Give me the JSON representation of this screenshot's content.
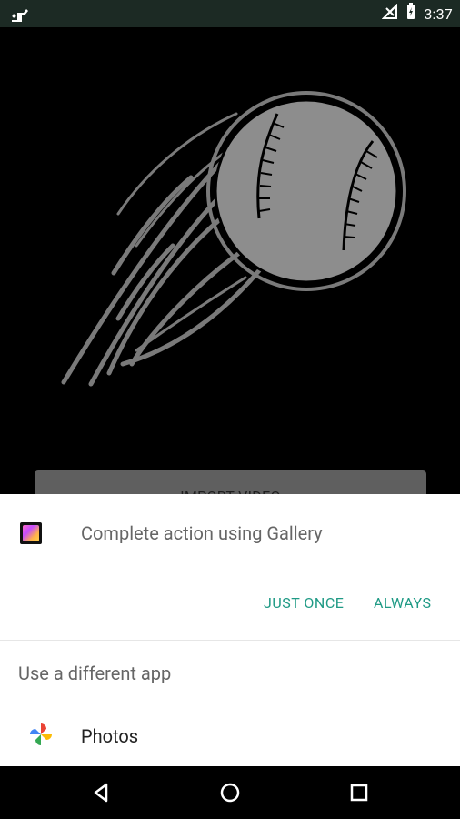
{
  "status_bar": {
    "time": "3:37"
  },
  "app": {
    "import_button_label": "IMPORT VIDEO"
  },
  "chooser": {
    "title": "Complete action using Gallery",
    "actions": {
      "just_once": "JUST ONCE",
      "always": "ALWAYS"
    },
    "different_app": "Use a different app",
    "options": [
      {
        "label": "Photos",
        "icon": "photos-icon"
      }
    ]
  },
  "nav": {
    "back": "back-icon",
    "home": "home-icon",
    "recents": "recents-icon"
  },
  "colors": {
    "status_bar_bg": "#1c2a24",
    "accent": "#1f9a85",
    "import_button_bg": "#5f5f5f"
  }
}
